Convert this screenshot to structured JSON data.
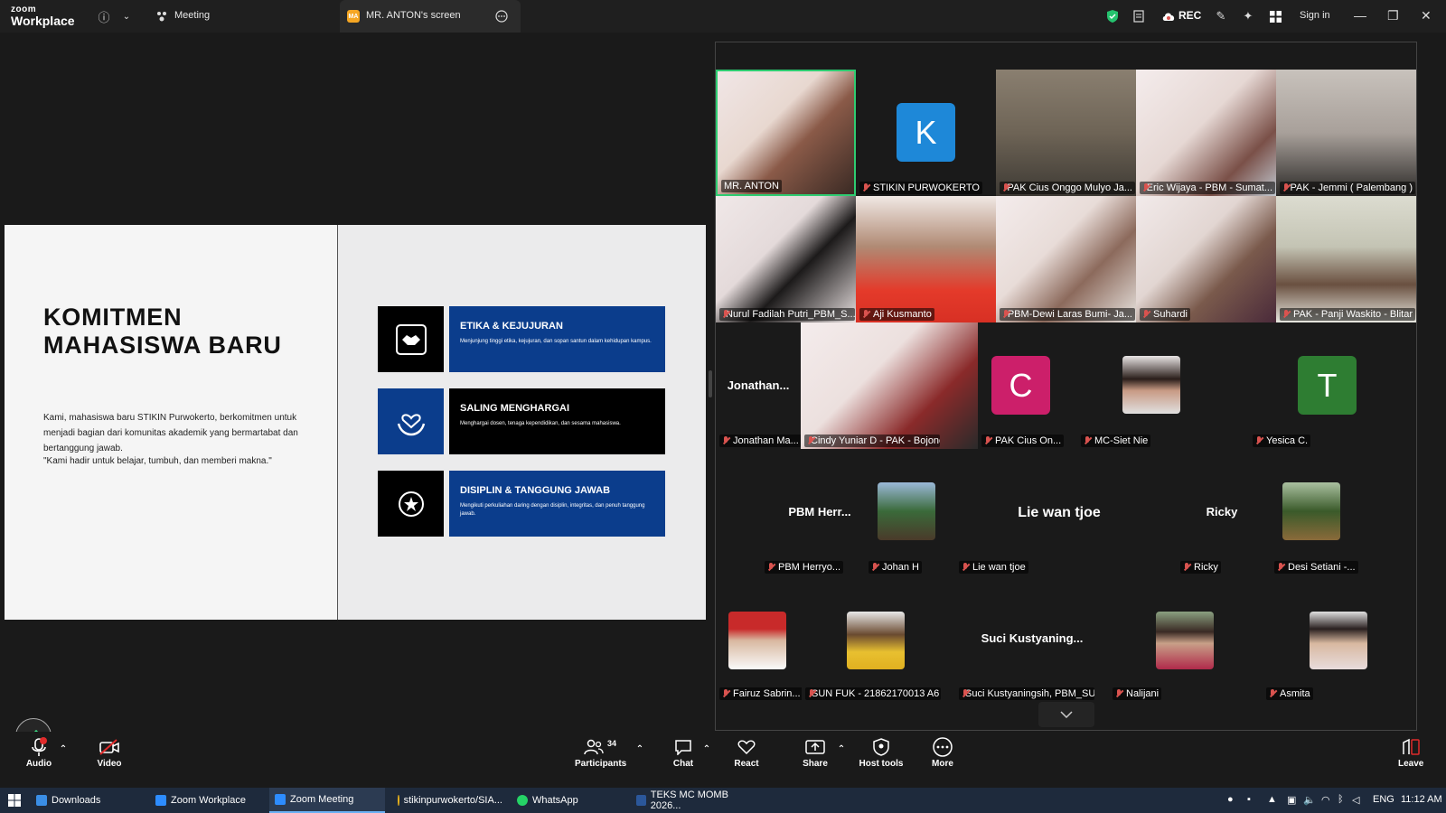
{
  "titlebar": {
    "brand_top": "zoom",
    "brand_bottom": "Workplace",
    "meeting_label": "Meeting",
    "screen_tab": "MR. ANTON's screen",
    "screen_badge": "MA",
    "rec": "REC",
    "sign_in": "Sign in"
  },
  "slide": {
    "title_line1": "KOMITMEN",
    "title_line2": "MAHASISWA BARU",
    "paragraph": "Kami, mahasiswa baru STIKIN Purwokerto, berkomitmen untuk menjadi bagian dari komunitas akademik yang bermartabat dan bertanggung jawab.",
    "quote": "\"Kami hadir untuk belajar, tumbuh, dan memberi makna.\"",
    "values": [
      {
        "title": "ETIKA & KEJUJURAN",
        "desc": "Menjunjung tinggi etika, kejujuran, dan sopan santun dalam kehidupan kampus."
      },
      {
        "title": "SALING MENGHARGAI",
        "desc": "Menghargai dosen, tenaga kependidikan, dan sesama mahasiswa."
      },
      {
        "title": "DISIPLIN & TANGGUNG JAWAB",
        "desc": "Mengikuti perkuliahan daring dengan disiplin, integritas, dan penuh tanggung jawab."
      }
    ]
  },
  "gallery": {
    "row1": [
      "MR. ANTON",
      "STIKIN PURWOKERTO",
      "PAK Cius Onggo Mulyo Ja...",
      "Eric Wijaya - PBM - Sumat...",
      "PAK - Jemmi ( Palembang )"
    ],
    "row1_letter": "K",
    "row2": [
      "Nurul Fadilah Putri_PBM_S...",
      "Aji Kusmanto",
      "PBM-Dewi Laras Bumi- Ja...",
      "Suhardi",
      "PAK - Panji Waskito - Blitar"
    ],
    "row3": [
      "Jonathan Ma...",
      "Cindy Yuniar D - PAK - Bojonegoro",
      "PAK Cius On...",
      "MC-Siet Nie",
      "Yesica C."
    ],
    "row3_center": "Jonathan...",
    "row3_letters": [
      "C",
      "T"
    ],
    "row4": [
      "PBM Herryo...",
      "Johan H",
      "Lie wan tjoe",
      "Ricky",
      "Desi Setiani -..."
    ],
    "row4_centers": [
      "PBM  Herr...",
      "Lie wan tjoe",
      "Ricky"
    ],
    "row5": [
      "Fairuz Sabrin...",
      "SUN FUK - 21862170013 A6",
      "Suci Kustyaningsih, PBM_SU...",
      "Nalijani",
      "Asmita"
    ],
    "row5_center": "Suci  Kustyaning..."
  },
  "toolbar": {
    "audio": "Audio",
    "video": "Video",
    "participants": "Participants",
    "participants_count": "34",
    "chat": "Chat",
    "react": "React",
    "share": "Share",
    "host_tools": "Host tools",
    "more": "More",
    "leave": "Leave"
  },
  "taskbar": {
    "items": [
      "Downloads",
      "Zoom Workplace",
      "Zoom Meeting",
      "stikinpurwokerto/SIA...",
      "WhatsApp",
      "TEKS MC MOMB 2026..."
    ],
    "lang": "ENG",
    "time": "11:12 AM"
  },
  "colors": {
    "accent_blue": "#0b3d8c",
    "active_speaker": "#2ecc71",
    "avatar_k": "#1e88d8",
    "avatar_c": "#cc1f6a",
    "avatar_t": "#2e7d32"
  }
}
